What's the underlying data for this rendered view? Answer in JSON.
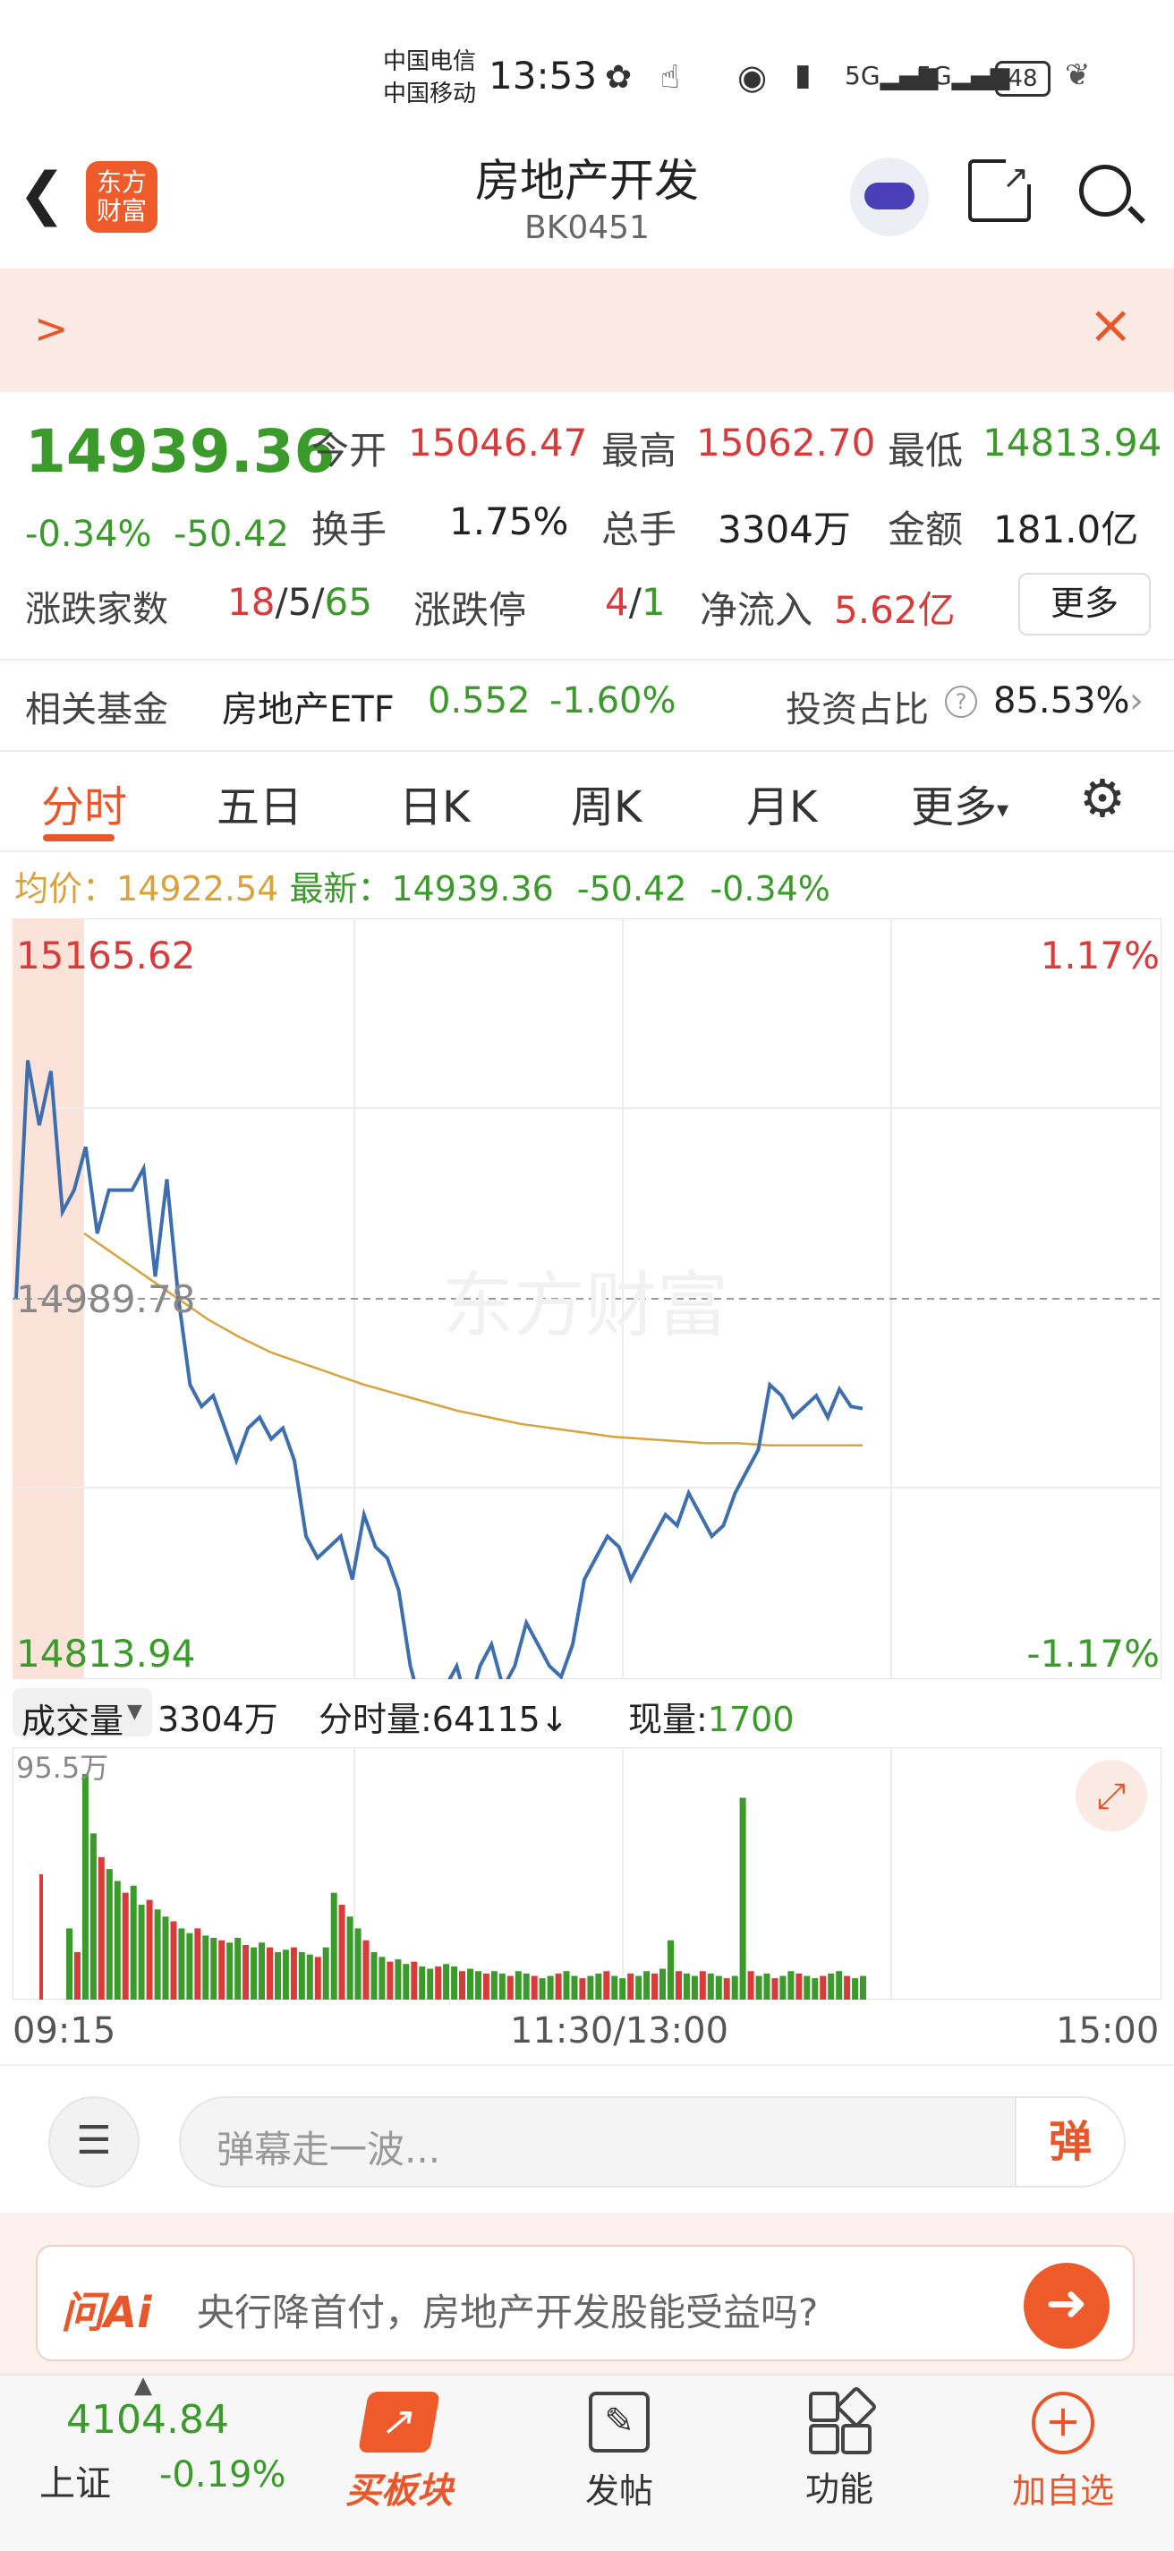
{
  "status_bar": {
    "carrier1": "中国电信",
    "carrier2": "中国移动",
    "time": "13:53",
    "battery": "48"
  },
  "header": {
    "title": "房地产开发",
    "code": "BK0451",
    "logo_text": "东方财富"
  },
  "banner": {
    "arrow": ">",
    "close": "×"
  },
  "quote": {
    "price": "14939.36",
    "change_pct": "-0.34%",
    "change": "-50.42",
    "open_label": "今开",
    "open": "15046.47",
    "high_label": "最高",
    "high": "15062.70",
    "low_label": "最低",
    "low": "14813.94",
    "turnover_label": "换手",
    "turnover": "1.75%",
    "volume_label": "总手",
    "volume": "3304万",
    "amount_label": "金额",
    "amount": "181.0亿",
    "adv_label": "涨跌家数",
    "adv_up": "18",
    "adv_flat": "5",
    "adv_down": "65",
    "limit_label": "涨跌停",
    "limit_up": "4",
    "limit_down": "1",
    "inflow_label": "净流入",
    "inflow": "5.62亿",
    "more": "更多"
  },
  "fund": {
    "label": "相关基金",
    "name": "房地产ETF",
    "price": "0.552",
    "pct": "-1.60%",
    "ratio_label": "投资占比",
    "ratio": "85.53%"
  },
  "tabs": [
    "分时",
    "五日",
    "日K",
    "周K",
    "月K",
    "更多"
  ],
  "avg_line": {
    "avg_label": "均价：",
    "avg": "14922.54",
    "latest_label": "最新：",
    "latest": "14939.36",
    "change": "-50.42",
    "pct": "-0.34%"
  },
  "chart_labels": {
    "top_price": "15165.62",
    "top_pct": "1.17%",
    "mid_price": "14989.78",
    "bottom_price": "14813.94",
    "bottom_pct": "-1.17%",
    "watermark": "东方财富"
  },
  "volume_bar": {
    "selector": "成交量",
    "total": "3304万",
    "tick_label": "分时量:64115↓",
    "now_label": "现量:",
    "now": "1700",
    "max": "95.5万"
  },
  "time_axis": [
    "09:15",
    "11:30/13:00",
    "15:00"
  ],
  "comment": {
    "placeholder": "弹幕走一波...",
    "danmu_icon": "弹"
  },
  "ai": {
    "logo": "问Ai",
    "question": "央行降首付，房地产开发股能受益吗?"
  },
  "bottom_nav": {
    "index_value": "4104.84",
    "index_name": "上证",
    "index_pct": "-0.19%",
    "buy_label": "买板块",
    "post_label": "发帖",
    "func_label": "功能",
    "add_label": "加自选"
  },
  "chart_data": {
    "type": "line",
    "price_series": [
      14990,
      15100,
      15070,
      15095,
      15030,
      15040,
      15060,
      15020,
      15040,
      15040,
      15040,
      15050,
      15000,
      15045,
      14990,
      14950,
      14940,
      14945,
      14930,
      14915,
      14930,
      14935,
      14925,
      14930,
      14915,
      14880,
      14870,
      14875,
      14880,
      14860,
      14890,
      14875,
      14870,
      14855,
      14820,
      14800,
      14790,
      14810,
      14820,
      14800,
      14820,
      14830,
      14810,
      14820,
      14840,
      14830,
      14820,
      14815,
      14830,
      14860,
      14870,
      14880,
      14875,
      14860,
      14870,
      14880,
      14890,
      14885,
      14900,
      14890,
      14880,
      14885,
      14900,
      14910,
      14920,
      14950,
      14945,
      14935,
      14940,
      14945,
      14935,
      14948,
      14940,
      14939
    ],
    "avg_series": [
      15020,
      15010,
      15000,
      14990,
      14980,
      14972,
      14965,
      14960,
      14955,
      14950,
      14946,
      14942,
      14938,
      14935,
      14932,
      14930,
      14928,
      14926,
      14925,
      14924,
      14923,
      14923,
      14922,
      14922,
      14922,
      14922
    ],
    "volume_series": [
      30,
      20,
      95,
      70,
      60,
      55,
      50,
      45,
      48,
      40,
      42,
      38,
      35,
      33,
      30,
      28,
      30,
      27,
      26,
      25,
      24,
      26,
      23,
      22,
      24,
      22,
      20,
      21,
      22,
      20,
      19,
      18,
      22,
      45,
      40,
      35,
      30,
      25,
      20,
      18,
      16,
      17,
      15,
      16,
      14,
      13,
      14,
      15,
      14,
      12,
      13,
      12,
      11,
      12,
      11,
      10,
      12,
      11,
      10,
      9,
      10,
      11,
      12,
      10,
      9,
      10,
      11,
      12,
      10,
      9,
      11,
      10,
      12,
      11,
      13,
      25,
      12,
      11,
      10,
      12,
      11,
      10,
      9,
      10,
      85,
      12,
      10,
      11,
      9,
      10,
      12,
      11,
      10,
      9,
      10,
      11,
      12,
      10,
      9,
      10
    ],
    "ylim": [
      14813.94,
      15165.62
    ],
    "xlabels": [
      "09:15",
      "11:30/13:00",
      "15:00"
    ]
  },
  "colors": {
    "accent": "#e8572a",
    "up": "#d93a3a",
    "down": "#3a9a2a",
    "price_line": "#3d6fb0",
    "avg_line": "#d9a23a"
  }
}
